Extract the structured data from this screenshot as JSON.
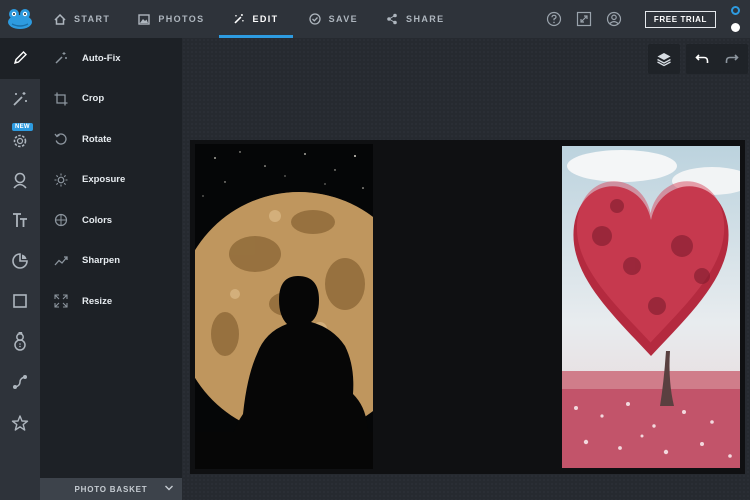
{
  "app": {
    "logo_icon": "frog-logo-icon",
    "brand_color": "#2d9be0"
  },
  "nav": {
    "tabs": [
      {
        "label": "START",
        "icon": "home-icon",
        "active": false
      },
      {
        "label": "PHOTOS",
        "icon": "image-icon",
        "active": false
      },
      {
        "label": "EDIT",
        "icon": "magic-wand-icon",
        "active": true
      },
      {
        "label": "SAVE",
        "icon": "check-circle-icon",
        "active": false
      },
      {
        "label": "SHARE",
        "icon": "share-icon",
        "active": false
      }
    ],
    "right_icons": [
      "help-icon",
      "fullscreen-icon",
      "account-icon"
    ],
    "free_trial_label": "FREE TRIAL"
  },
  "rail": {
    "items": [
      "pencil-icon",
      "wand-sparkle-icon",
      "gear-icon",
      "portrait-icon",
      "text-icon",
      "sticker-icon",
      "frame-icon",
      "snowman-icon",
      "texture-icon",
      "star-icon"
    ],
    "new_badge": "NEW"
  },
  "edit_panel": {
    "items": [
      {
        "label": "Auto-Fix",
        "icon": "auto-fix-icon"
      },
      {
        "label": "Crop",
        "icon": "crop-icon"
      },
      {
        "label": "Rotate",
        "icon": "rotate-icon"
      },
      {
        "label": "Exposure",
        "icon": "sun-icon"
      },
      {
        "label": "Colors",
        "icon": "colors-icon"
      },
      {
        "label": "Sharpen",
        "icon": "sharpen-icon"
      },
      {
        "label": "Resize",
        "icon": "resize-icon"
      }
    ]
  },
  "photo_basket": {
    "label": "PHOTO BASKET"
  },
  "workspace": {
    "tools": [
      "layers-icon",
      "undo-icon",
      "redo-icon"
    ],
    "photos": [
      "moon-silhouette-photo",
      "heart-tree-photo"
    ]
  }
}
